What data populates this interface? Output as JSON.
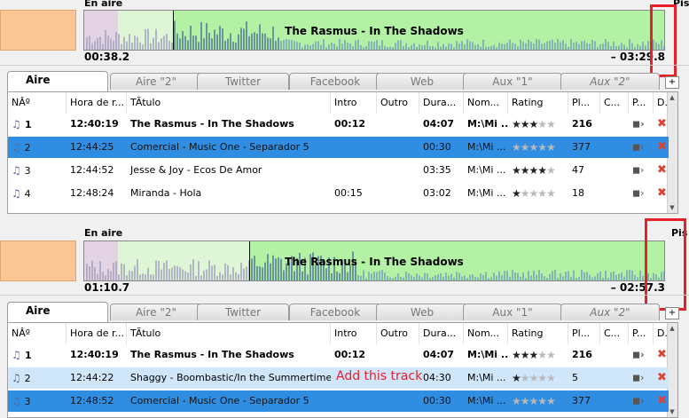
{
  "panels": [
    {
      "on_air_label": "En aire",
      "right_cut_label": "Pis",
      "elapsed": "00:38.2",
      "remaining": "– 03:29.8",
      "wave_title": "The Rasmus - In The Shadows",
      "tabs": [
        {
          "label": "Aire",
          "active": true,
          "italic": false
        },
        {
          "label": "Aire \"2\"",
          "active": false,
          "italic": false
        },
        {
          "label": "Twitter",
          "active": false,
          "italic": false
        },
        {
          "label": "Facebook",
          "active": false,
          "italic": false
        },
        {
          "label": "Web",
          "active": false,
          "italic": false
        },
        {
          "label": "Aux \"1\"",
          "active": false,
          "italic": false
        },
        {
          "label": "Aux \"2\"",
          "active": false,
          "italic": true
        }
      ],
      "columns": [
        "NÂº",
        "Hora de r...",
        "TÃ­tulo",
        "Intro",
        "Outro",
        "Dura...",
        "Nom...",
        "Rating",
        "Pl...",
        "C...",
        "P...",
        "D..."
      ],
      "rows": [
        {
          "num": "1",
          "hora": "12:40:19",
          "titulo": "The Rasmus - In The Shadows",
          "intro": "00:12",
          "outro": "",
          "dura": "04:07",
          "nom": "M:\\Mi ...",
          "rating": 3.5,
          "pl": "216",
          "style": "bold"
        },
        {
          "num": "2",
          "hora": "12:44:25",
          "titulo": "Comercial - Music One - Separador 5",
          "intro": "",
          "outro": "",
          "dura": "00:30",
          "nom": "M:\\Mi ...",
          "rating": 0,
          "pl": "377",
          "style": "sel"
        },
        {
          "num": "3",
          "hora": "12:44:52",
          "titulo": "Jesse & Joy - Ecos De Amor",
          "intro": "",
          "outro": "",
          "dura": "03:35",
          "nom": "M:\\Mi ...",
          "rating": 4,
          "pl": "47",
          "style": ""
        },
        {
          "num": "4",
          "hora": "12:48:24",
          "titulo": "Miranda - Hola",
          "intro": "00:15",
          "outro": "",
          "dura": "03:02",
          "nom": "M:\\Mi ...",
          "rating": 1,
          "pl": "18",
          "style": ""
        }
      ]
    },
    {
      "on_air_label": "En aire",
      "right_cut_label": "Pis",
      "elapsed": "01:10.7",
      "remaining": "– 02:57.3",
      "wave_title": "The Rasmus - In The Shadows",
      "tabs": [
        {
          "label": "Aire",
          "active": true,
          "italic": false
        },
        {
          "label": "Aire \"2\"",
          "active": false,
          "italic": false
        },
        {
          "label": "Twitter",
          "active": false,
          "italic": false
        },
        {
          "label": "Facebook",
          "active": false,
          "italic": false
        },
        {
          "label": "Web",
          "active": false,
          "italic": false
        },
        {
          "label": "Aux \"1\"",
          "active": false,
          "italic": false
        },
        {
          "label": "Aux \"2\"",
          "active": false,
          "italic": true
        }
      ],
      "columns": [
        "NÂº",
        "Hora de r...",
        "TÃ­tulo",
        "Intro",
        "Outro",
        "Dura...",
        "Nom...",
        "Rating",
        "Pl...",
        "C...",
        "P...",
        "D..."
      ],
      "rows": [
        {
          "num": "1",
          "hora": "12:40:19",
          "titulo": "The Rasmus - In The Shadows",
          "intro": "00:12",
          "outro": "",
          "dura": "04:07",
          "nom": "M:\\Mi ...",
          "rating": 3.5,
          "pl": "216",
          "style": "bold"
        },
        {
          "num": "2",
          "hora": "12:44:22",
          "titulo": "Shaggy - Boombastic/In the Summertime [Sti...",
          "intro": "",
          "outro": "",
          "dura": "04:30",
          "nom": "M:\\Mi ...",
          "rating": 1,
          "pl": "5",
          "style": "hl"
        },
        {
          "num": "3",
          "hora": "12:48:52",
          "titulo": "Comercial - Music One - Separador 5",
          "intro": "",
          "outro": "",
          "dura": "00:30",
          "nom": "M:\\Mi ...",
          "rating": 0,
          "pl": "377",
          "style": "sel"
        }
      ],
      "annotation": "Add this track"
    }
  ],
  "colors": {
    "wave": "#b3f2a5",
    "selected": "#2f8ee2",
    "highlight": "#cfe6fb",
    "annotation": "#e8202a"
  }
}
